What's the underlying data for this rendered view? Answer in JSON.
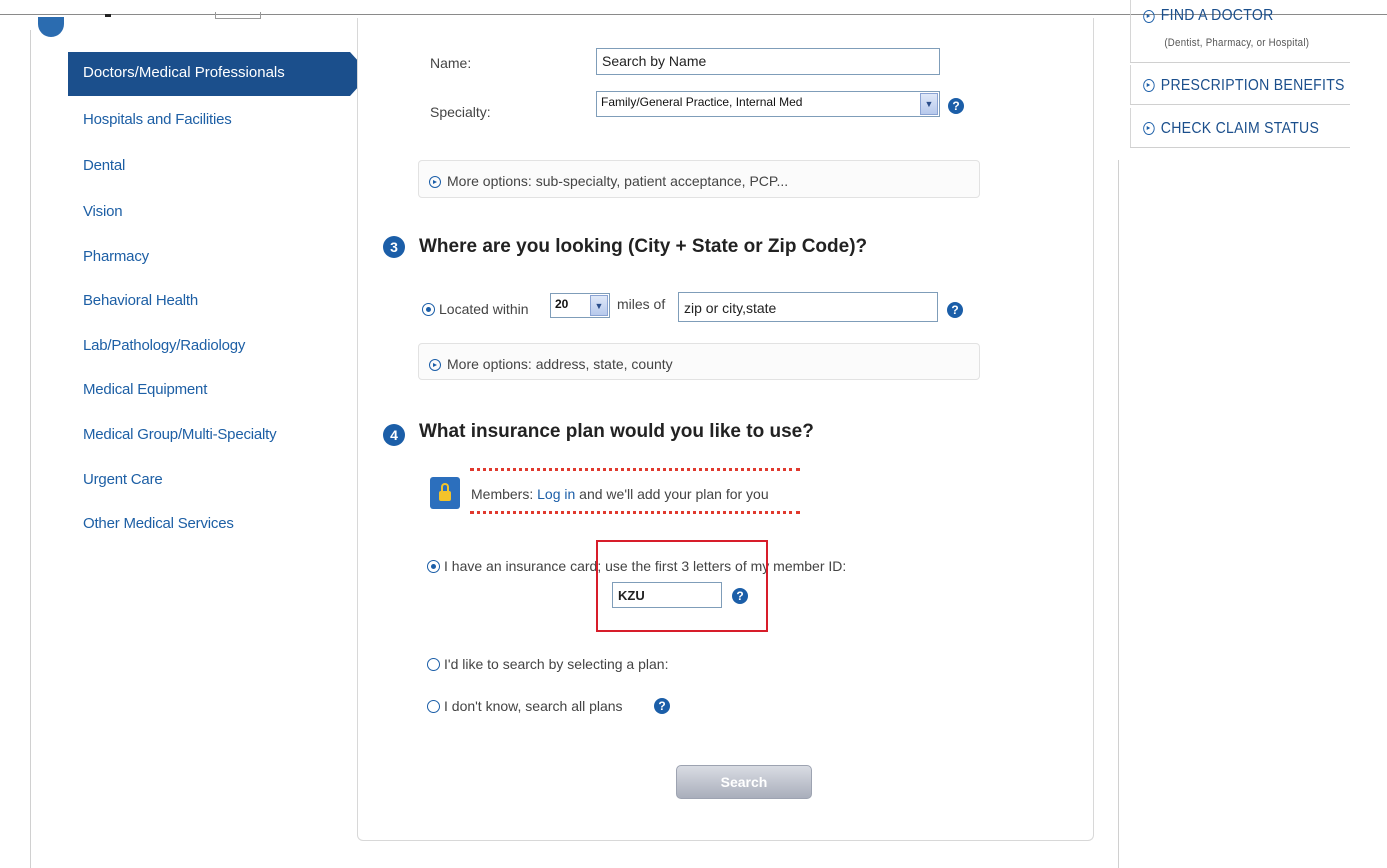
{
  "nav": {
    "items": [
      {
        "label": "Doctors/Medical Professionals",
        "active": true
      },
      {
        "label": "Hospitals and Facilities"
      },
      {
        "label": "Dental"
      },
      {
        "label": "Vision"
      },
      {
        "label": "Pharmacy"
      },
      {
        "label": "Behavioral Health"
      },
      {
        "label": "Lab/Pathology/Radiology"
      },
      {
        "label": "Medical Equipment"
      },
      {
        "label": "Medical Group/Multi-Specialty"
      },
      {
        "label": "Urgent Care"
      },
      {
        "label": "Other Medical Services"
      }
    ]
  },
  "search_form": {
    "name_label": "Name:",
    "name_value": "Search by Name",
    "specialty_label": "Specialty:",
    "specialty_value": "Family/General Practice, Internal Med",
    "more_options_1": "More options: sub-specialty, patient acceptance, PCP...",
    "step3_number": "3",
    "step3_title": "Where are you looking (City + State or Zip Code)?",
    "located_within_label": "Located within",
    "miles_value": "20",
    "miles_of_label": "miles of",
    "location_value": "zip or city,state",
    "more_options_2": "More options: address, state, county",
    "step4_number": "4",
    "step4_title": "What insurance plan would you like to use?",
    "members_text_1": "Members: ",
    "login_link": "Log in",
    "members_text_2": " and we'll add your plan for you",
    "option_card": "I have an insurance card; use the first 3 letters of my member ID:",
    "member_id_value": "KZU",
    "option_select_plan": "I'd like to search by selecting a plan:",
    "option_all_plans": "I don't know, search all plans",
    "search_button": "Search",
    "help_glyph": "?"
  },
  "right_links": {
    "find_doctor": "FIND A DOCTOR",
    "find_doctor_sub": "(Dentist, Pharmacy, or Hospital)",
    "prescription": "PRESCRIPTION BENEFITS",
    "claim_status": "CHECK CLAIM STATUS"
  },
  "colors": {
    "accent": "#1b5ea8",
    "nav_active": "#1b4f8c",
    "highlight": "#d71d2a"
  }
}
